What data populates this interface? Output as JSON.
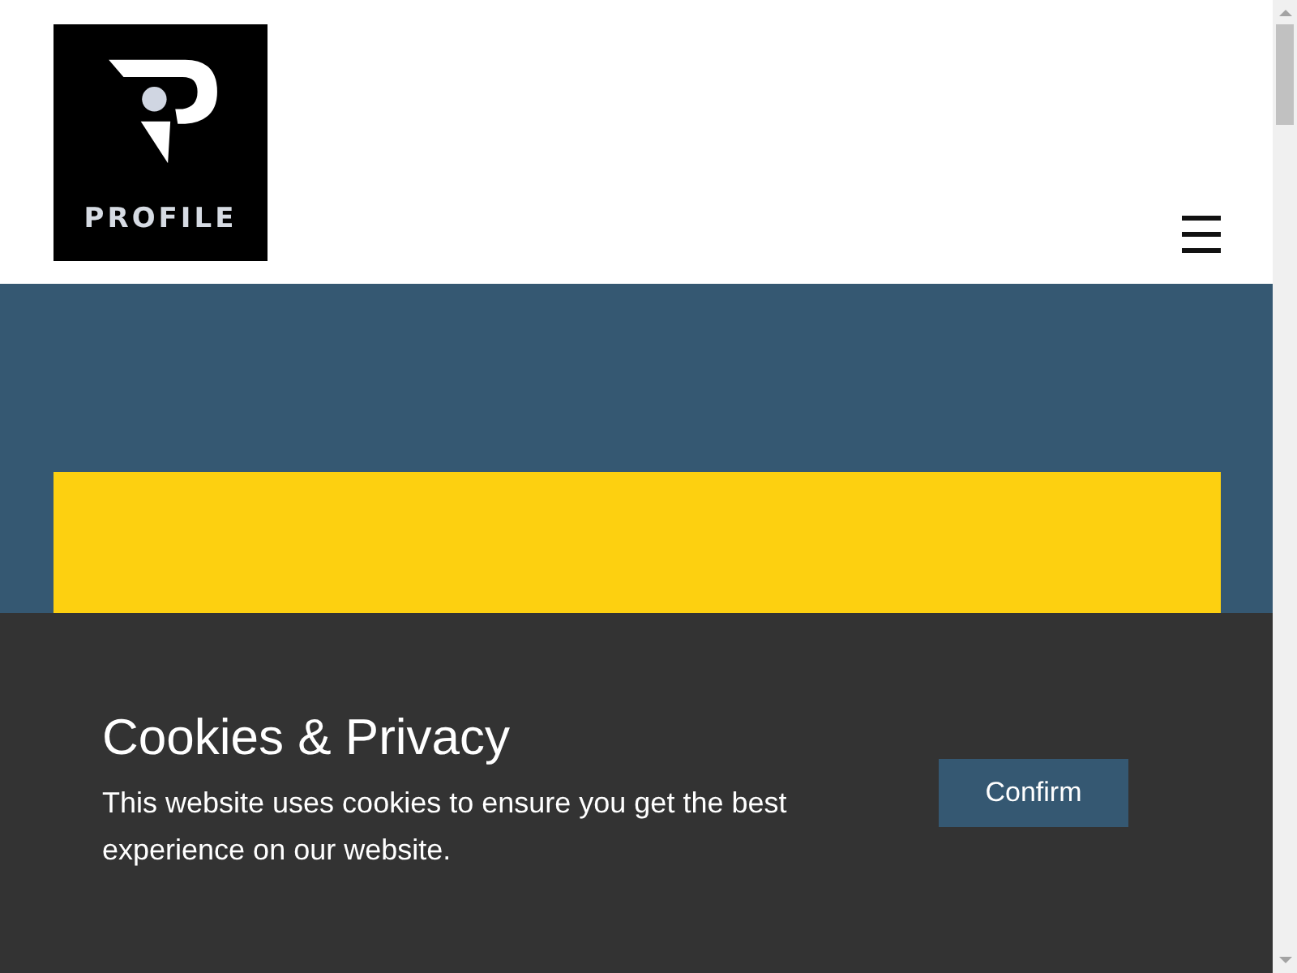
{
  "header": {
    "logo_text": "PROFILE"
  },
  "cookie_banner": {
    "title": "Cookies & Privacy",
    "message": "This website uses cookies to ensure you get the best experience on our website.",
    "button": "Confirm"
  }
}
